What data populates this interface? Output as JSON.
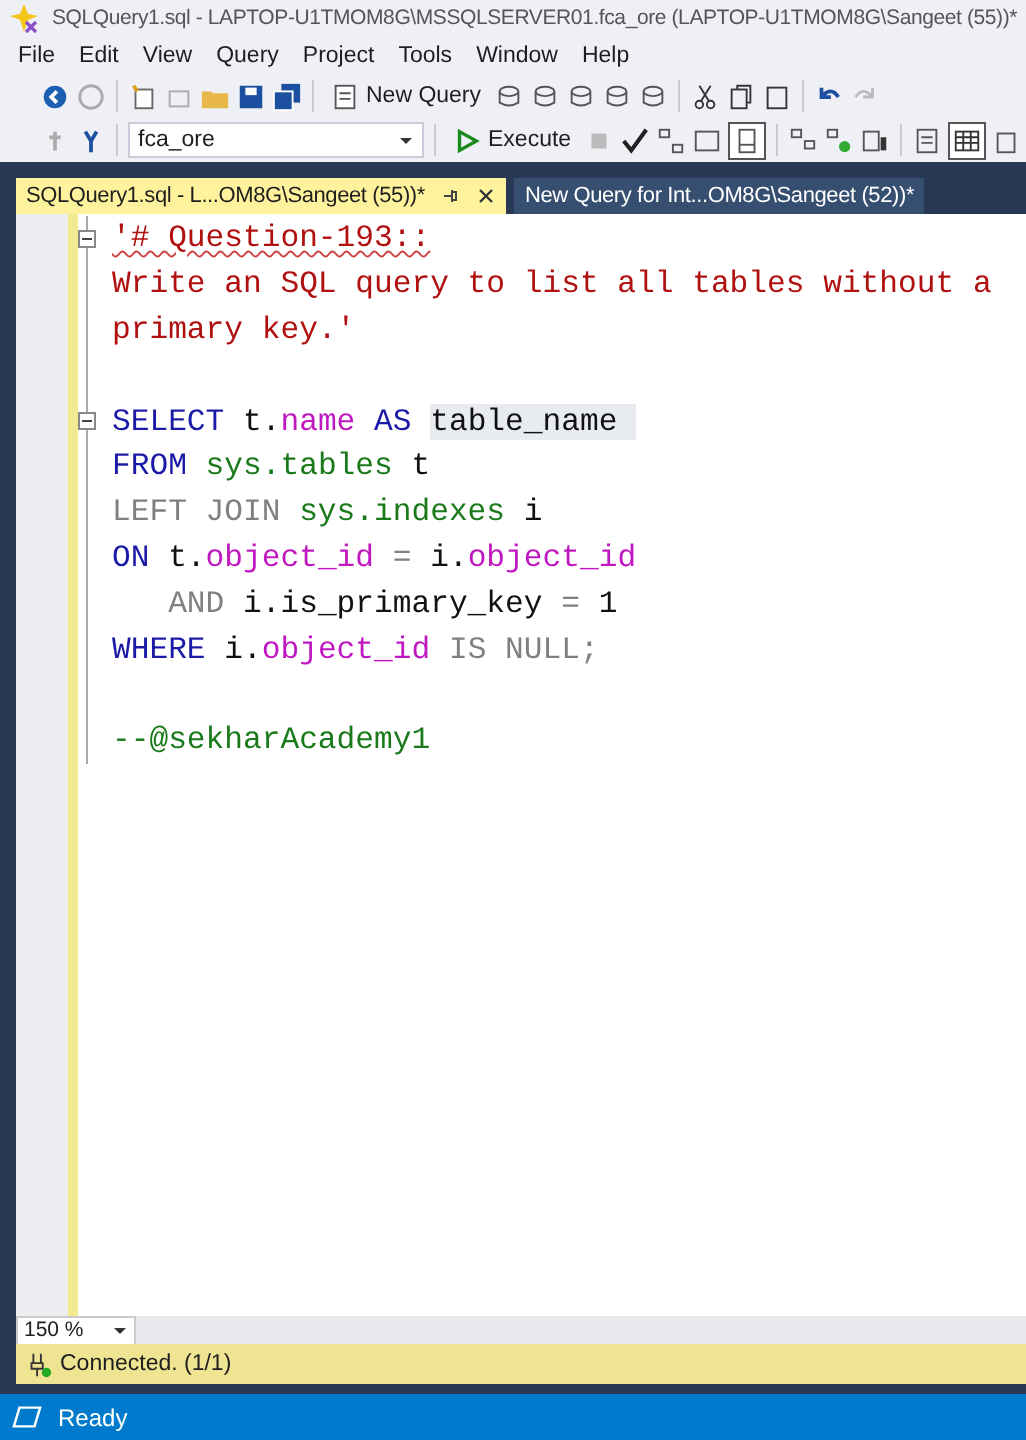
{
  "window": {
    "title": "SQLQuery1.sql - LAPTOP-U1TMOM8G\\MSSQLSERVER01.fca_ore (LAPTOP-U1TMOM8G\\Sangeet (55))*"
  },
  "menu": [
    "File",
    "Edit",
    "View",
    "Query",
    "Project",
    "Tools",
    "Window",
    "Help"
  ],
  "toolbar": {
    "new_query": "New Query",
    "database": "fca_ore",
    "execute": "Execute"
  },
  "tabs": [
    {
      "label": "SQLQuery1.sql - L...OM8G\\Sangeet (55))*",
      "selected": true
    },
    {
      "label": "New Query for Int...OM8G\\Sangeet (52))*",
      "selected": false
    }
  ],
  "editor": {
    "lines": [
      {
        "fold": true,
        "tokens": [
          {
            "kind": "string",
            "text": "'# Question-193::"
          }
        ]
      },
      {
        "fold": false,
        "tokens": [
          {
            "kind": "string",
            "text": "Write an SQL query to list all tables without a"
          }
        ]
      },
      {
        "fold": false,
        "tokens": [
          {
            "kind": "string",
            "text": "primary key.'"
          }
        ]
      },
      {
        "fold": false
      },
      {
        "fold": true,
        "tokens": [
          {
            "kind": "keyword",
            "text": "SELECT"
          },
          {
            "kind": "plain",
            "text": " t."
          },
          {
            "kind": "column",
            "text": "name"
          },
          {
            "kind": "keyword",
            "text": " AS "
          },
          {
            "kind": "highlight",
            "text": "table_name "
          }
        ]
      },
      {
        "fold": false,
        "tokens": [
          {
            "kind": "keyword",
            "text": "FROM "
          },
          {
            "kind": "system",
            "text": "sys.tables"
          },
          {
            "kind": "plain",
            "text": " t"
          }
        ]
      },
      {
        "fold": false,
        "tokens": [
          {
            "kind": "operator",
            "text": "LEFT JOIN "
          },
          {
            "kind": "system",
            "text": "sys.indexes"
          },
          {
            "kind": "plain",
            "text": " i"
          }
        ]
      },
      {
        "fold": false,
        "tokens": [
          {
            "kind": "keyword",
            "text": "ON"
          },
          {
            "kind": "plain",
            "text": " t."
          },
          {
            "kind": "column",
            "text": "object_id"
          },
          {
            "kind": "operator",
            "text": " = "
          },
          {
            "kind": "plain",
            "text": "i."
          },
          {
            "kind": "column",
            "text": "object_id"
          }
        ]
      },
      {
        "fold": false,
        "tokens": [
          {
            "kind": "operator",
            "text": "   AND"
          },
          {
            "kind": "plain",
            "text": " i.is_primary_key "
          },
          {
            "kind": "operator",
            "text": "="
          },
          {
            "kind": "plain",
            "text": " 1"
          }
        ]
      },
      {
        "fold": false,
        "tokens": [
          {
            "kind": "keyword",
            "text": "WHERE"
          },
          {
            "kind": "plain",
            "text": " i."
          },
          {
            "kind": "column",
            "text": "object_id"
          },
          {
            "kind": "operator",
            "text": " IS NULL;"
          }
        ]
      },
      {
        "fold": false
      },
      {
        "fold": false,
        "tokens": [
          {
            "kind": "comment",
            "text": "--@sekharAcademy1"
          }
        ]
      }
    ]
  },
  "zoom": "150 %",
  "connection": "Connected. (1/1)",
  "status_bar": "Ready"
}
